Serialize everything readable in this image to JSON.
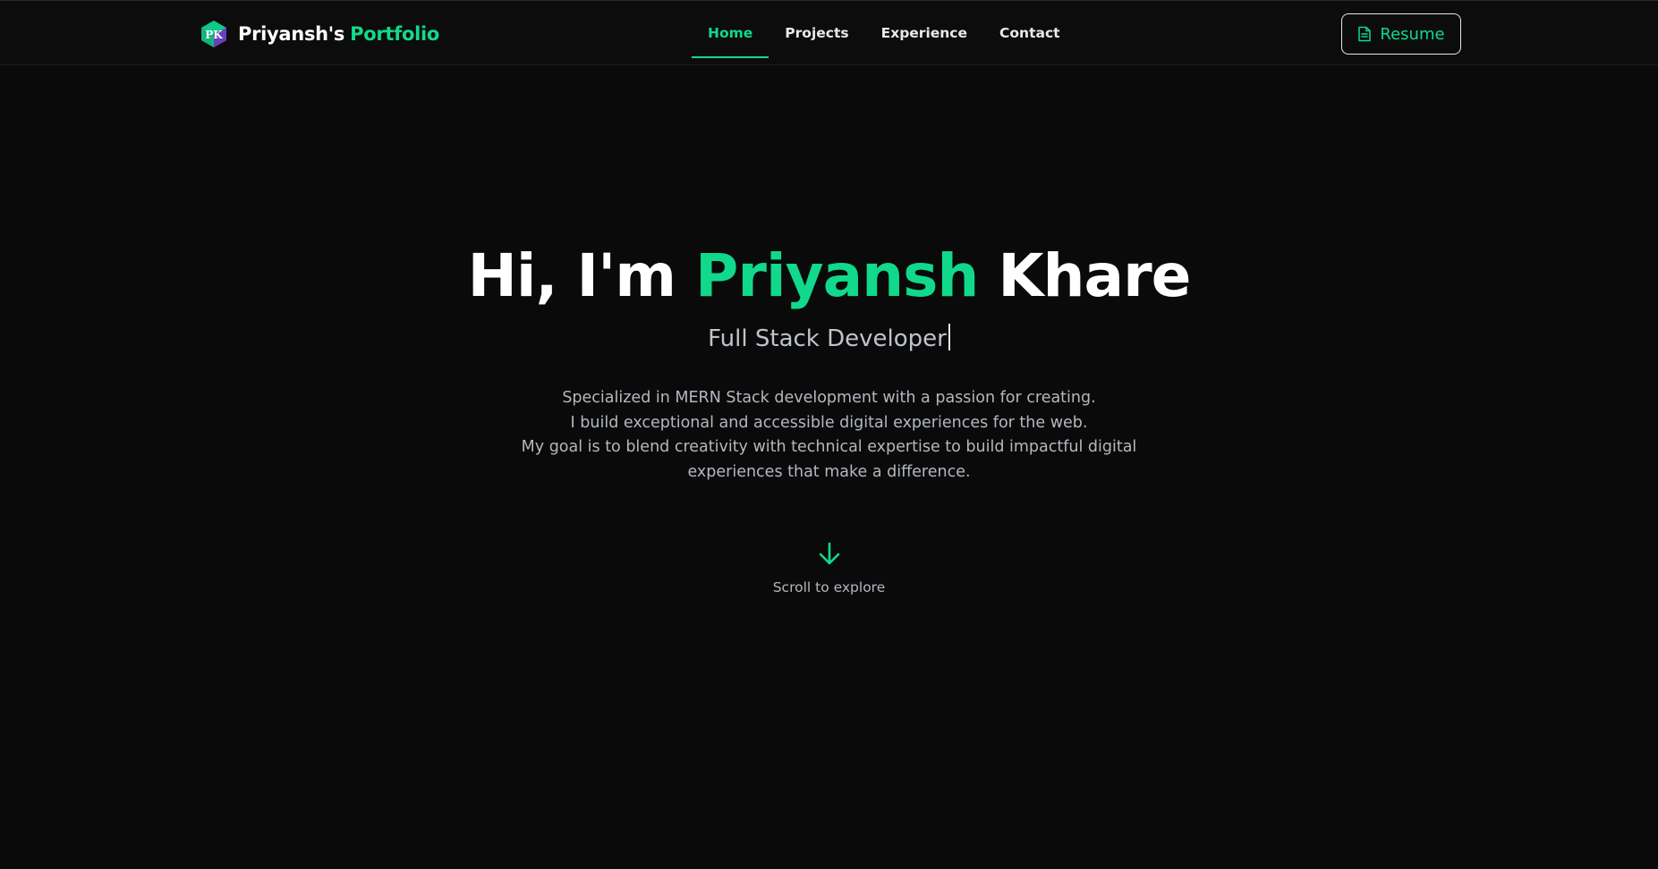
{
  "nav": {
    "brand_name": "Priyansh's",
    "brand_accent": "Portfolio",
    "logo_text": "PK",
    "items": [
      {
        "label": "Home",
        "active": true
      },
      {
        "label": "Projects",
        "active": false
      },
      {
        "label": "Experience",
        "active": false
      },
      {
        "label": "Contact",
        "active": false
      }
    ],
    "resume_label": "Resume",
    "resume_icon": "file-text-icon"
  },
  "hero": {
    "greeting": "Hi, I'm",
    "first_name": "Priyansh",
    "last_name": "Khare",
    "role": "Full Stack Developer",
    "description": [
      "Specialized in MERN Stack development with a passion for creating.",
      "I build exceptional and accessible digital experiences for the web.",
      "My goal is to blend creativity with technical expertise to build impactful digital experiences that make a difference."
    ]
  },
  "scroll": {
    "label": "Scroll to explore",
    "icon": "arrow-down-icon"
  },
  "colors": {
    "background": "#0a0a0a",
    "accent": "#10d98c",
    "text": "#ffffff",
    "muted": "#b3b8c0"
  }
}
